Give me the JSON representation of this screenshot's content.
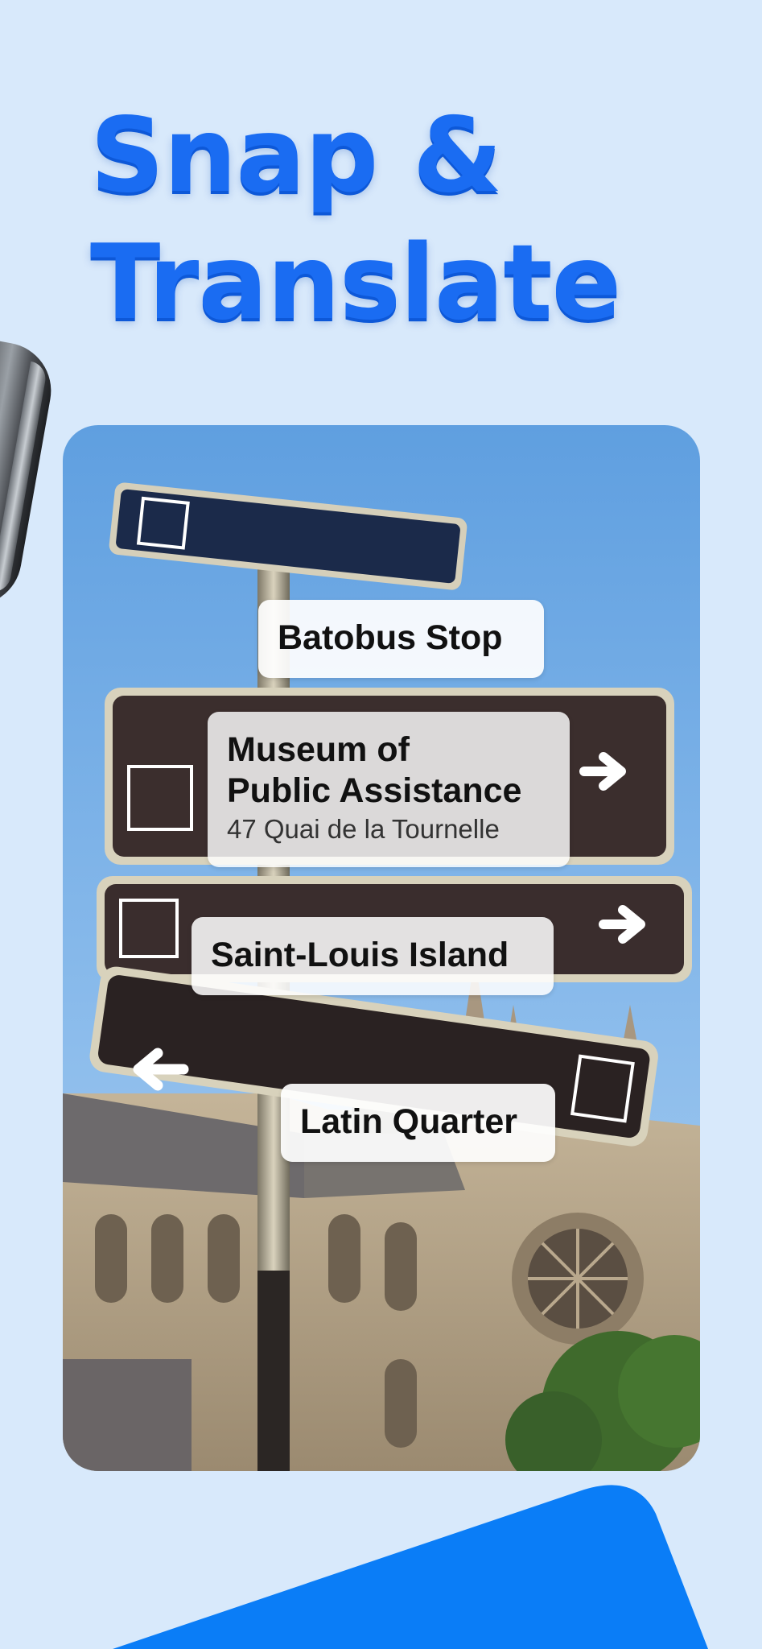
{
  "headline": {
    "line1": "Snap &",
    "line2": "Translate"
  },
  "labels": {
    "batobus": "Batobus Stop",
    "museum_title_1": "Museum of",
    "museum_title_2": "Public Assistance",
    "museum_address": "47 Quai de la Tournelle",
    "saint_louis": "Saint-Louis Island",
    "latin_quarter": "Latin Quarter"
  },
  "colors": {
    "background": "#d8e9fb",
    "accent": "#1a6cf2",
    "blue_shape": "#0a7df7"
  }
}
